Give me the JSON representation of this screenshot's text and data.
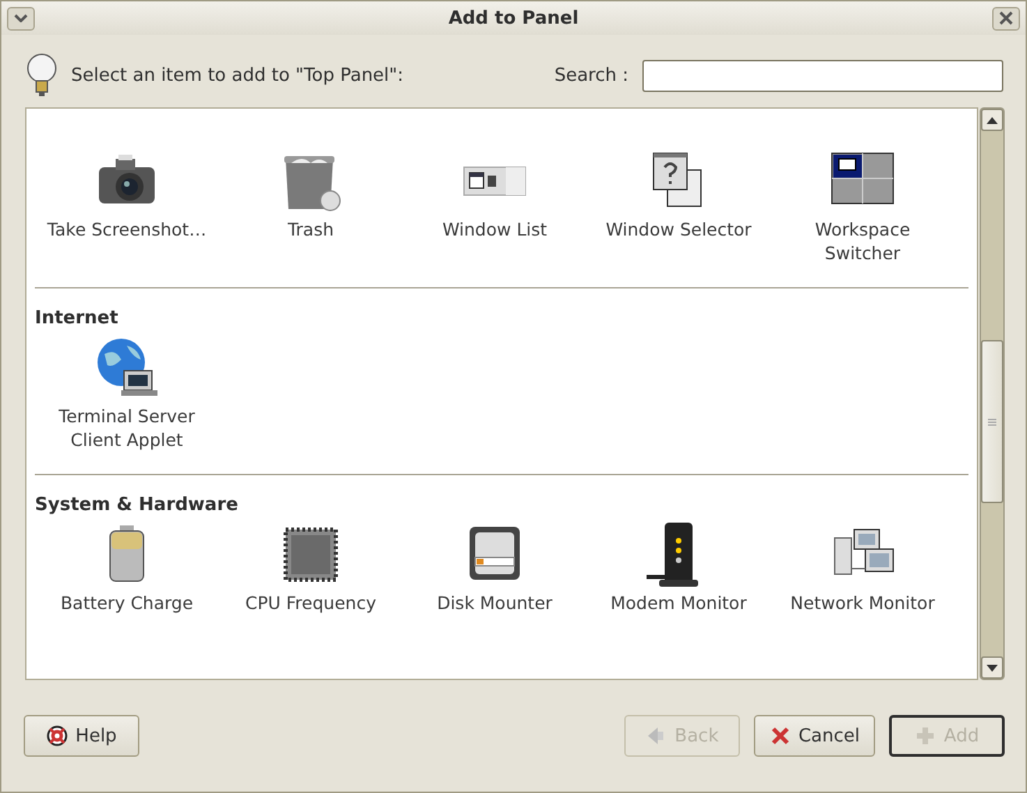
{
  "window": {
    "title": "Add to Panel"
  },
  "header": {
    "prompt": "Select an item to add to \"Top Panel\":",
    "search_label": "Search :"
  },
  "sections": [
    {
      "items": [
        {
          "label": "Take Screenshot…",
          "kind": "camera"
        },
        {
          "label": "Trash",
          "kind": "trash"
        },
        {
          "label": "Window List",
          "kind": "windowlist"
        },
        {
          "label": "Window Selector",
          "kind": "windowselector"
        },
        {
          "label": "Workspace Switcher",
          "kind": "workspace"
        }
      ]
    },
    {
      "heading": "Internet",
      "items": [
        {
          "label": "Terminal Server Client Applet",
          "kind": "globe"
        }
      ]
    },
    {
      "heading": "System & Hardware",
      "items": [
        {
          "label": "Battery Charge",
          "kind": "battery"
        },
        {
          "label": "CPU Frequency",
          "kind": "cpu"
        },
        {
          "label": "Disk Mounter",
          "kind": "disk"
        },
        {
          "label": "Modem Monitor",
          "kind": "modem"
        },
        {
          "label": "Network Monitor",
          "kind": "network"
        }
      ]
    }
  ],
  "buttons": [
    {
      "label": "Help",
      "kind": "help",
      "disabled": false,
      "default": false
    },
    {
      "label": "Back",
      "kind": "back",
      "disabled": true,
      "default": false
    },
    {
      "label": "Cancel",
      "kind": "cancel",
      "disabled": false,
      "default": false
    },
    {
      "label": "Add",
      "kind": "add",
      "disabled": true,
      "default": true
    }
  ]
}
